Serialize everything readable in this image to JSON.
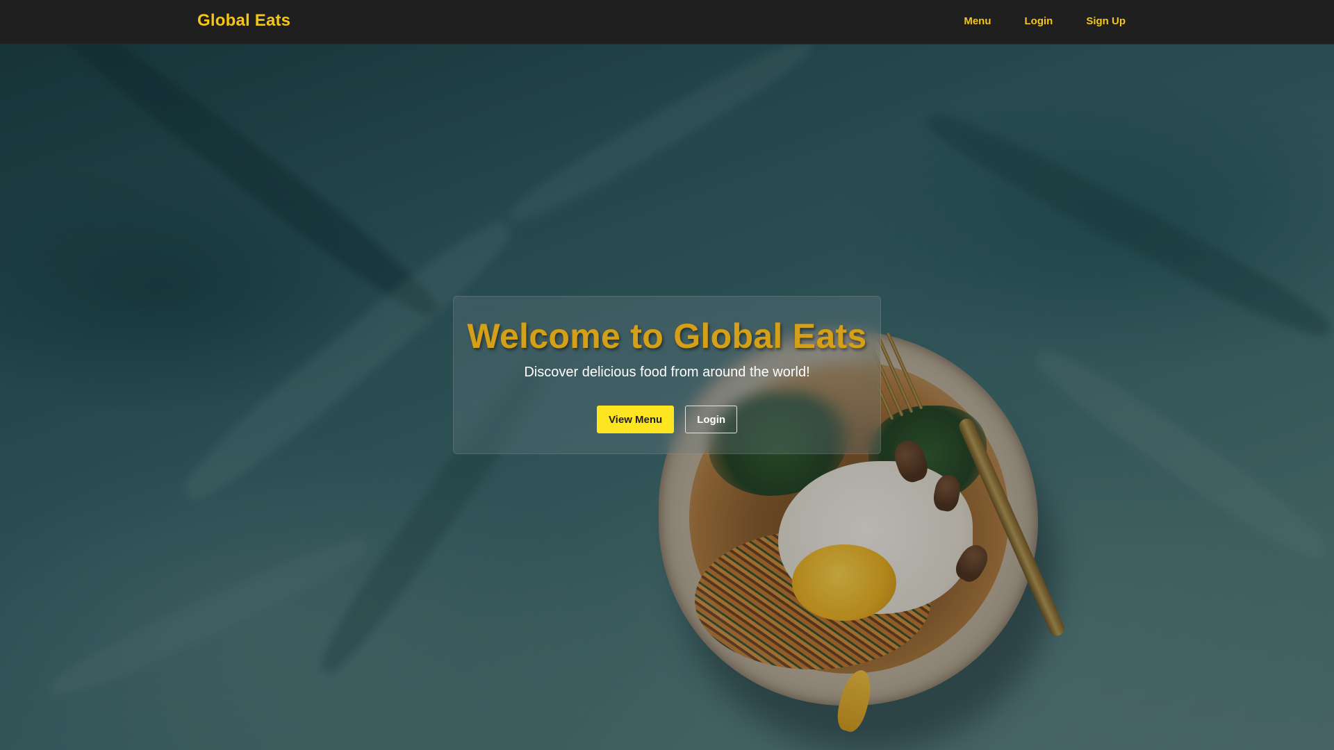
{
  "navbar": {
    "brand": "Global Eats",
    "links": [
      {
        "label": "Menu"
      },
      {
        "label": "Login"
      },
      {
        "label": "Sign Up"
      }
    ]
  },
  "hero": {
    "title": "Welcome to Global Eats",
    "subtitle": "Discover delicious food from around the world!",
    "buttons": {
      "primary_label": "View Menu",
      "secondary_label": "Login"
    },
    "background_image": "food-plate-teal-painted-background"
  },
  "colors": {
    "accent": "#f5c518",
    "button_primary": "#fde521",
    "navbar_bg": "#1f1f1f",
    "title": "#d4a01a"
  }
}
